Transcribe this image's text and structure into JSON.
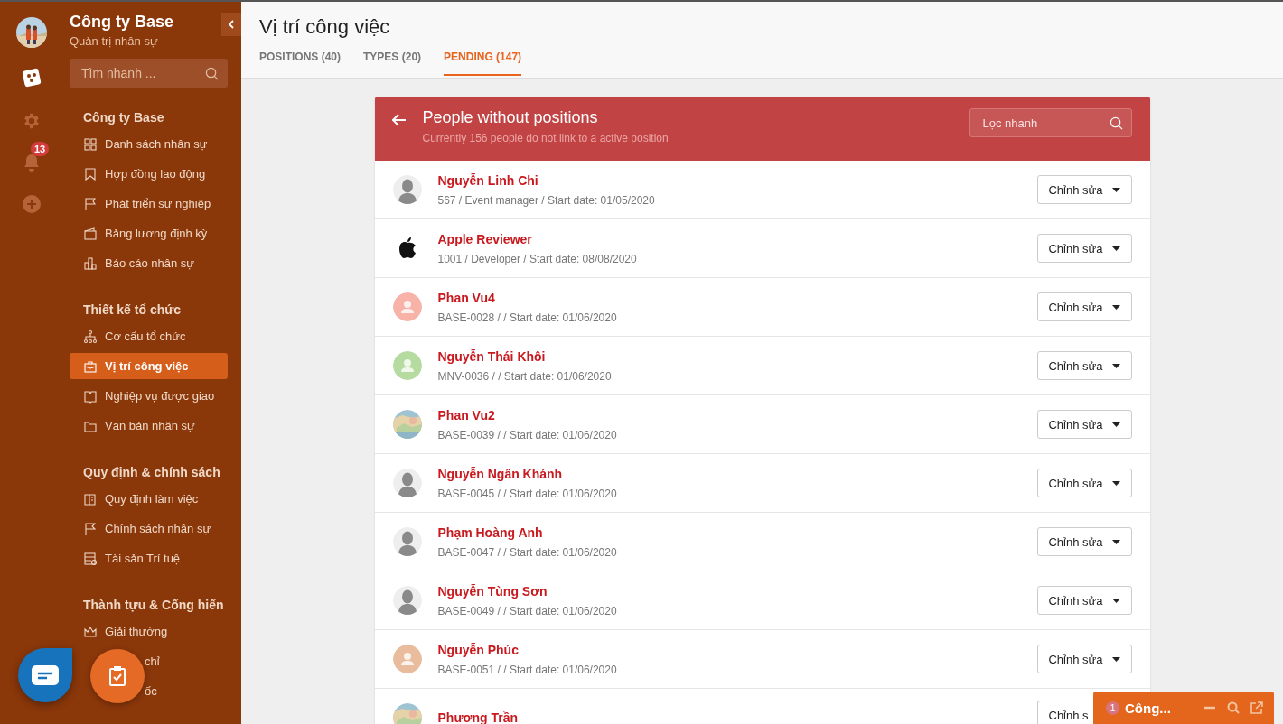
{
  "sidebar": {
    "company": "Công ty Base",
    "subtitle": "Quản trị nhân sự",
    "search": {
      "placeholder": "Tìm nhanh ..."
    },
    "notification_count": "13",
    "groups": [
      {
        "title": "Công ty Base",
        "items": [
          {
            "label": "Danh sách nhân sự",
            "selected": false,
            "covered": false
          },
          {
            "label": "Hợp đồng lao động",
            "selected": false,
            "covered": false
          },
          {
            "label": "Phát triển sự nghiệp",
            "selected": false,
            "covered": false
          },
          {
            "label": "Bảng lương định kỳ",
            "selected": false,
            "covered": false
          },
          {
            "label": "Báo cáo nhân sự",
            "selected": false,
            "covered": false
          }
        ]
      },
      {
        "title": "Thiết kế tổ chức",
        "items": [
          {
            "label": "Cơ cấu tổ chức",
            "selected": false,
            "covered": false
          },
          {
            "label": "Vị trí công việc",
            "selected": true,
            "covered": false
          },
          {
            "label": "Nghiệp vụ được giao",
            "selected": false,
            "covered": false
          },
          {
            "label": "Văn bản nhân sự",
            "selected": false,
            "covered": false
          }
        ]
      },
      {
        "title": "Quy định & chính sách",
        "items": [
          {
            "label": "Quy định làm việc",
            "selected": false,
            "covered": false
          },
          {
            "label": "Chính sách nhân sự",
            "selected": false,
            "covered": false
          },
          {
            "label": "Tài sản Trí tuệ",
            "selected": false,
            "covered": false
          }
        ]
      },
      {
        "title": "Thành tựu & Cống hiến",
        "items": [
          {
            "label": "Giải thưởng",
            "selected": false,
            "covered": false
          },
          {
            "label": "chỉ",
            "selected": false,
            "covered": true
          },
          {
            "label": "ốc",
            "selected": false,
            "covered": true
          }
        ]
      }
    ]
  },
  "page": {
    "title": "Vị trí công việc",
    "tabs": [
      {
        "label": "POSITIONS (40)",
        "selected": false
      },
      {
        "label": "TYPES (20)",
        "selected": false
      },
      {
        "label": "PENDING (147)",
        "selected": true
      }
    ]
  },
  "panel": {
    "title": "People without positions",
    "subtitle": "Currently 156 people do not link to a active position",
    "filter": {
      "placeholder": "Lọc nhanh"
    },
    "people": [
      {
        "name": "Nguyễn Linh Chi",
        "meta": "567 / Event manager / Start date: 01/05/2020",
        "avatar": {
          "kind": "silhouette"
        },
        "action": "Chỉnh sửa",
        "covered": false
      },
      {
        "name": "Apple Reviewer",
        "meta": "1001 / Developer / Start date: 08/08/2020",
        "avatar": {
          "kind": "apple"
        },
        "action": "Chỉnh sửa",
        "covered": false
      },
      {
        "name": "Phan Vu4",
        "meta": "BASE-0028 / / Start date: 01/06/2020",
        "avatar": {
          "kind": "placeholder",
          "color": "#f7b3a8"
        },
        "action": "Chỉnh sửa",
        "covered": false
      },
      {
        "name": "Nguyễn Thái Khôi",
        "meta": "MNV-0036 / / Start date: 01/06/2020",
        "avatar": {
          "kind": "placeholder",
          "color": "#b5dba0"
        },
        "action": "Chỉnh sửa",
        "covered": false
      },
      {
        "name": "Phan Vu2",
        "meta": "BASE-0039 / / Start date: 01/06/2020",
        "action": "Chỉnh sửa",
        "covered": false
      },
      {
        "name": "Nguyễn Ngân Khánh",
        "meta": "BASE-0045 / / Start date: 01/06/2020",
        "avatar": {
          "kind": "silhouette"
        },
        "action": "Chỉnh sửa",
        "covered": false
      },
      {
        "name": "Phạm Hoàng Anh",
        "meta": "BASE-0047 / / Start date: 01/06/2020",
        "avatar": {
          "kind": "silhouette"
        },
        "action": "Chỉnh sửa",
        "covered": false
      },
      {
        "name": "Nguyễn Tùng Sơn",
        "meta": "BASE-0049 / / Start date: 01/06/2020",
        "avatar": {
          "kind": "silhouette"
        },
        "action": "Chỉnh sửa",
        "covered": false
      },
      {
        "name": "Nguyễn Phúc",
        "meta": "BASE-0051 / / Start date: 01/06/2020",
        "avatar": {
          "kind": "placeholder",
          "color": "#e8bc9c"
        },
        "action": "Chỉnh sửa",
        "covered": false
      },
      {
        "name": "Phương Trần",
        "action": "Chỉnh s",
        "covered": true
      }
    ]
  },
  "chat_widget": {
    "count": "1",
    "title": "Công..."
  }
}
